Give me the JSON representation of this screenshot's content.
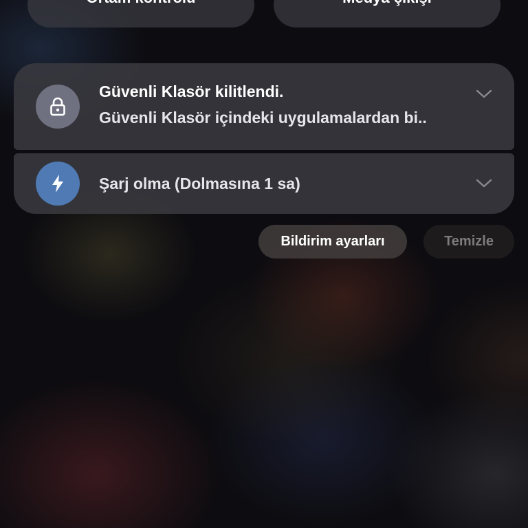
{
  "quick_panel": {
    "left_button_label": "Ortam kontrolü",
    "right_button_label": "Medya çıkışı"
  },
  "notifications": [
    {
      "app": "Güvenli Klasör",
      "icon": "lock-icon",
      "icon_bg": "#6f7180",
      "title": "Güvenli Klasör kilitlendi.",
      "body": "Güvenli Klasör içindeki uygulamalardan bi.."
    },
    {
      "app": "Şarj",
      "icon": "bolt-icon",
      "icon_bg": "#4f7ab4",
      "title": "Şarj olma (Dolmasına 1 sa)"
    }
  ],
  "actions": {
    "settings_label": "Bildirim ayarları",
    "clear_label": "Temizle"
  }
}
